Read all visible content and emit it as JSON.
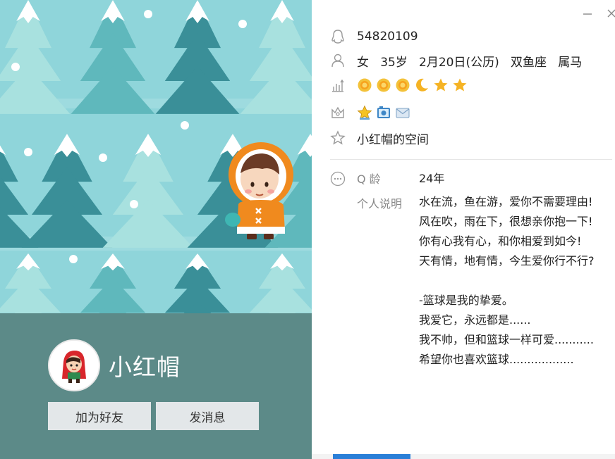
{
  "colors": {
    "sky": "#8fd5da",
    "tree_dark": "#3a8f98",
    "tree_mid": "#5fb8bc",
    "tree_light": "#a8e1df",
    "snow": "#ffffff",
    "profile_bar": "#5c8a88",
    "button_bg": "#e3e7e9",
    "parka": "#f08a1e",
    "star": "#f5b324",
    "taskbar_accent": "#2a7fd8"
  },
  "window": {
    "minimize_icon": "minus-icon",
    "close_icon": "close-icon"
  },
  "profile": {
    "nickname": "小红帽",
    "add_friend_label": "加为好友",
    "send_message_label": "发消息"
  },
  "info": {
    "qq_number": "54820109",
    "basic": "女   35岁   2月20日(公历)   双鱼座   属马",
    "level_badges": [
      "sun-icon",
      "sun-icon",
      "sun-icon",
      "moon-icon",
      "star-icon",
      "star-icon"
    ],
    "service_badges": [
      "star-badge-icon",
      "camera-badge-icon",
      "mail-badge-icon"
    ],
    "space_label": "小红帽的空间"
  },
  "details": {
    "q_age_label": "Q 龄",
    "q_age_value": "24年",
    "bio_label": "个人说明",
    "bio_lines": [
      "水在流，鱼在游，爱你不需要理由!",
      "风在吹，雨在下，很想亲你抱一下!",
      "你有心我有心，和你相爱到如今!",
      "天有情，地有情，今生爱你行不行?",
      "",
      "-篮球是我的挚爱。",
      "我爱它，永远都是......",
      "我不帅，但和篮球一样可爱...........",
      "希望你也喜欢篮球.................."
    ]
  }
}
